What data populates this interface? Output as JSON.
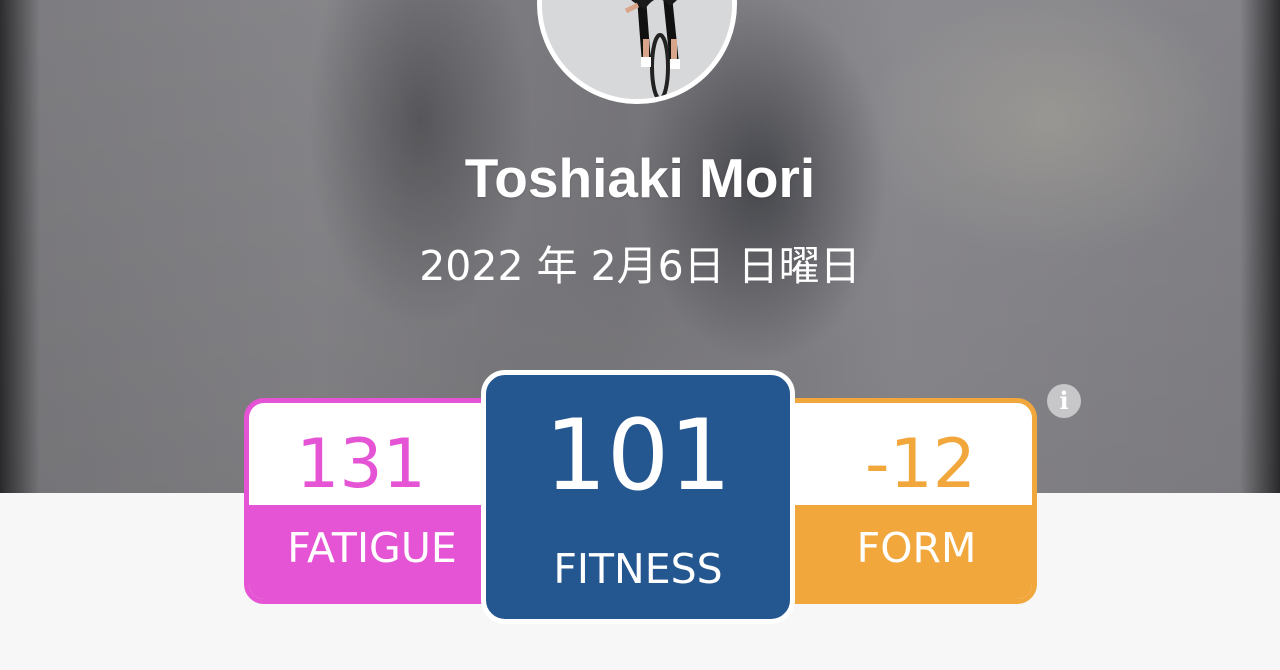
{
  "profile": {
    "name": "Toshiaki Mori",
    "date": "2022 年 2月6日 日曜日"
  },
  "metrics": {
    "fatigue": {
      "value": "131",
      "label": "FATIGUE"
    },
    "fitness": {
      "value": "101",
      "label": "FITNESS"
    },
    "form": {
      "value": "-12",
      "label": "FORM"
    }
  },
  "icons": {
    "info": "info-icon",
    "info_glyph": "i"
  },
  "colors": {
    "fatigue": "#e554d4",
    "fitness": "#24568f",
    "form": "#f1a73b"
  }
}
